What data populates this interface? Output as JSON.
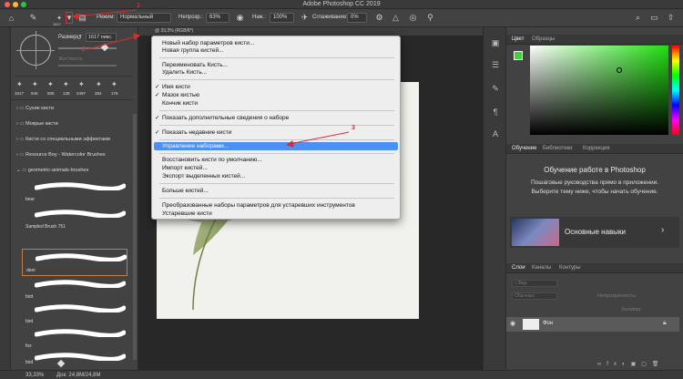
{
  "window": {
    "title": "Adobe Photoshop CC 2019"
  },
  "colors": {
    "accent": "#4c8ff7",
    "annotation": "#e02a2a",
    "green_swatch": "#3fd23a"
  },
  "options_bar": {
    "mode_label": "Режим:",
    "mode_value": "Нормальный",
    "opacity_label": "Непрозр.:",
    "opacity_value": "63%",
    "pressure_label": "Наж.:",
    "pressure_value": "100%",
    "smoothing_label": "Сглаживание:",
    "smoothing_value": "0%",
    "brush_size_badge": "1617"
  },
  "brush_panel": {
    "size_label": "Размер:",
    "size_value": "1617 пикс.",
    "hardness_label": "Жесткость",
    "presets": [
      "1617",
      "945",
      "505",
      "128",
      "2497",
      "284",
      "176"
    ],
    "groups": [
      "Сухие кисти",
      "Мокрые кисти",
      "Кисти со специальными эффектами",
      "Resource Boy - Watercolor Brushes",
      "geometric-animals-brushes"
    ],
    "brushes": [
      "bear",
      "Sampled Brush 751",
      "deer",
      "bird",
      "bird",
      "fox",
      "bird"
    ]
  },
  "document": {
    "tab": "@ 33,3% (RGB/8*)"
  },
  "flyout_menu": {
    "items": [
      {
        "label": "Новый набор параметров кисти...",
        "checked": false
      },
      {
        "label": "Новая группа кистей...",
        "checked": false
      },
      {
        "label": "Переименовать Кисть...",
        "checked": false
      },
      {
        "label": "Удалить Кисть...",
        "checked": false
      },
      {
        "label": "Имя кисти",
        "checked": true
      },
      {
        "label": "Мазок кистью",
        "checked": true
      },
      {
        "label": "Кончик кисти",
        "checked": false
      },
      {
        "label": "Показать дополнительные сведения о наборе",
        "checked": true
      },
      {
        "label": "Показать недавние кисти",
        "checked": true
      },
      {
        "label": "Управление наборами...",
        "checked": false,
        "highlighted": true
      },
      {
        "label": "Восстановить кисти по умолчанию...",
        "checked": false
      },
      {
        "label": "Импорт кистей...",
        "checked": false
      },
      {
        "label": "Экспорт выделенных кистей...",
        "checked": false
      },
      {
        "label": "Больше кистей...",
        "checked": false
      },
      {
        "label": "Преобразованные наборы параметров для устаревших инструментов",
        "checked": false
      },
      {
        "label": "Устаревшие кисти",
        "checked": false
      }
    ]
  },
  "right_panel": {
    "color_tabs": [
      "Цвет",
      "Образцы"
    ],
    "learn_tabs": [
      "Обучение",
      "Библиотеки",
      "Коррекция"
    ],
    "learn_title": "Обучение работе в Photoshop",
    "learn_text": "Пошаговые руководства прямо в приложении. Выберите тему ниже, чтобы начать обучение.",
    "learn_card": "Основные навыки",
    "layers_tabs": [
      "Слои",
      "Каналы",
      "Контуры"
    ],
    "layer_kind": "Обычные",
    "layer_opacity_label": "Непрозрачность:",
    "layer_fill_label": "Заливка:",
    "layer_name": "Фон"
  },
  "status_bar": {
    "zoom": "33,33%",
    "doc": "Док: 24,8M/24,8M"
  },
  "annotations": {
    "a1": "1",
    "a2": "2",
    "a3": "3"
  }
}
